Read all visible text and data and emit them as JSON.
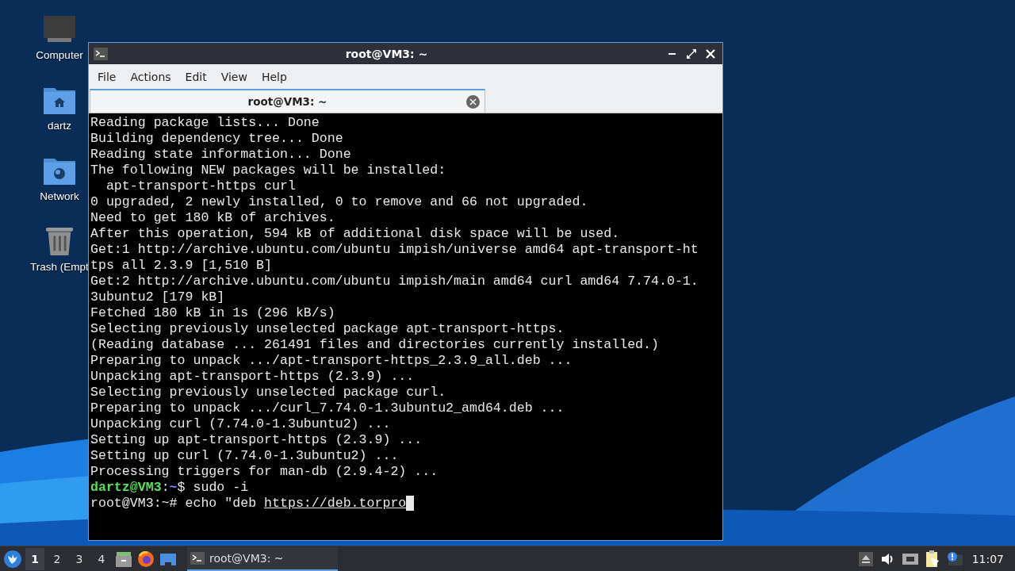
{
  "desktop_icons": [
    {
      "label": "Computer",
      "kind": "computer"
    },
    {
      "label": "dartz",
      "kind": "home"
    },
    {
      "label": "Network",
      "kind": "network"
    },
    {
      "label": "Trash (Empt",
      "kind": "trash"
    }
  ],
  "window": {
    "title": "root@VM3: ~",
    "menu": [
      "File",
      "Actions",
      "Edit",
      "View",
      "Help"
    ],
    "tabs": [
      {
        "label": "root@VM3: ~",
        "selected": true
      }
    ],
    "lines": [
      {
        "text": "Reading package lists... Done"
      },
      {
        "text": "Building dependency tree... Done"
      },
      {
        "text": "Reading state information... Done"
      },
      {
        "text": "The following NEW packages will be installed:"
      },
      {
        "text": "  apt-transport-https curl"
      },
      {
        "text": "0 upgraded, 2 newly installed, 0 to remove and 66 not upgraded."
      },
      {
        "text": "Need to get 180 kB of archives."
      },
      {
        "text": "After this operation, 594 kB of additional disk space will be used."
      },
      {
        "text": "Get:1 http://archive.ubuntu.com/ubuntu impish/universe amd64 apt-transport-ht"
      },
      {
        "text": "tps all 2.3.9 [1,510 B]"
      },
      {
        "text": "Get:2 http://archive.ubuntu.com/ubuntu impish/main amd64 curl amd64 7.74.0-1."
      },
      {
        "text": "3ubuntu2 [179 kB]"
      },
      {
        "text": "Fetched 180 kB in 1s (296 kB/s)"
      },
      {
        "text": "Selecting previously unselected package apt-transport-https."
      },
      {
        "text": "(Reading database ... 261491 files and directories currently installed.)"
      },
      {
        "text": "Preparing to unpack .../apt-transport-https_2.3.9_all.deb ..."
      },
      {
        "text": "Unpacking apt-transport-https (2.3.9) ..."
      },
      {
        "text": "Selecting previously unselected package curl."
      },
      {
        "text": "Preparing to unpack .../curl_7.74.0-1.3ubuntu2_amd64.deb ..."
      },
      {
        "text": "Unpacking curl (7.74.0-1.3ubuntu2) ..."
      },
      {
        "text": "Setting up apt-transport-https (2.3.9) ..."
      },
      {
        "text": "Setting up curl (7.74.0-1.3ubuntu2) ..."
      },
      {
        "text": "Processing triggers for man-db (2.9.4-2) ..."
      },
      {
        "parts": [
          {
            "text": "dartz@VM3",
            "kind": "user"
          },
          {
            "text": ":",
            "kind": "plain"
          },
          {
            "text": "~",
            "kind": "path"
          },
          {
            "text": "$ sudo -i",
            "kind": "plain"
          }
        ]
      },
      {
        "parts": [
          {
            "text": "root@VM3:~# echo \"deb ",
            "kind": "plain"
          },
          {
            "text": "https://deb.torpro",
            "kind": "link"
          }
        ],
        "cursor": true
      }
    ]
  },
  "taskbar": {
    "workspaces": [
      {
        "label": "1",
        "selected": true
      },
      {
        "label": "2",
        "selected": false
      },
      {
        "label": "3",
        "selected": false
      },
      {
        "label": "4",
        "selected": false
      }
    ],
    "tasks": [
      {
        "label": "root@VM3: ~",
        "selected": true
      }
    ],
    "clock": "11:07"
  }
}
